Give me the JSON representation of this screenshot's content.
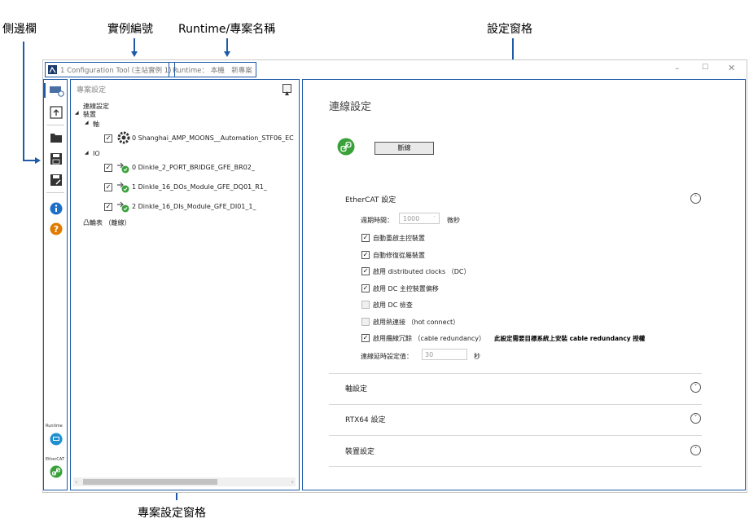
{
  "callouts": {
    "sidebar": "側邊欄",
    "instance_id": "實例編號",
    "runtime_project": "Runtime/專案名稱",
    "settings_pane": "設定窗格",
    "project_settings_pane": "專案設定窗格"
  },
  "titlebar": {
    "app_title": "1 Configuration Tool (主站實例 1)",
    "runtime_text": "Runtime： 本機　新專案",
    "minimize": "–",
    "maximize": "☐",
    "close": "✕"
  },
  "sidebar": {
    "runtime_label": "Runtime",
    "ethercat_label": "EtherCAT",
    "accent": "#1e5aa8"
  },
  "project": {
    "header": "專案設定",
    "tree": {
      "connection_settings": "連線設定",
      "devices": "裝置",
      "axis": "軸",
      "axis_device": "0  Shanghai_AMP_MOONS__Automation_STF06_EC",
      "io": "IO",
      "io_device_0": "0  Dinkle_2_PORT_BRIDGE_GFE_BR02_",
      "io_device_1": "1  Dinkle_16_DOs_Module_GFE_DQ01_R1_",
      "io_device_2": "2  Dinkle_16_DIs_Module_GFE_DI01_1_",
      "cam_table": "凸輪表 （離線）"
    }
  },
  "settings": {
    "title": "連線設定",
    "disconnect_button": "斷線",
    "ethercat_section": "EtherCAT 設定",
    "cycle_time_label": "週期時間：",
    "cycle_time_value": "1000",
    "cycle_time_unit": "微秒",
    "options": [
      {
        "label": "自動重啟主控裝置",
        "checked": true
      },
      {
        "label": "自動修復從屬裝置",
        "checked": true
      },
      {
        "label": "啟用 distributed clocks （DC）",
        "checked": true
      },
      {
        "label": "啟用 DC 主控裝置偏移",
        "checked": true
      },
      {
        "label": "啟用 DC 檢查",
        "checked": false
      },
      {
        "label": "啟用熱連接 （hot connect）",
        "checked": false
      },
      {
        "label": "啟用纜線冗餘 （cable redundancy）",
        "checked": true
      }
    ],
    "redundancy_note": "此設定需要目標系統上安裝 cable redundancy 授權",
    "connection_delay_label": "連線延時設定值：",
    "connection_delay_value": "30",
    "connection_delay_unit": "秒",
    "axis_section": "軸設定",
    "rtx_section": "RTX64 設定",
    "device_section": "裝置設定",
    "link_color": "#3aa13a"
  }
}
